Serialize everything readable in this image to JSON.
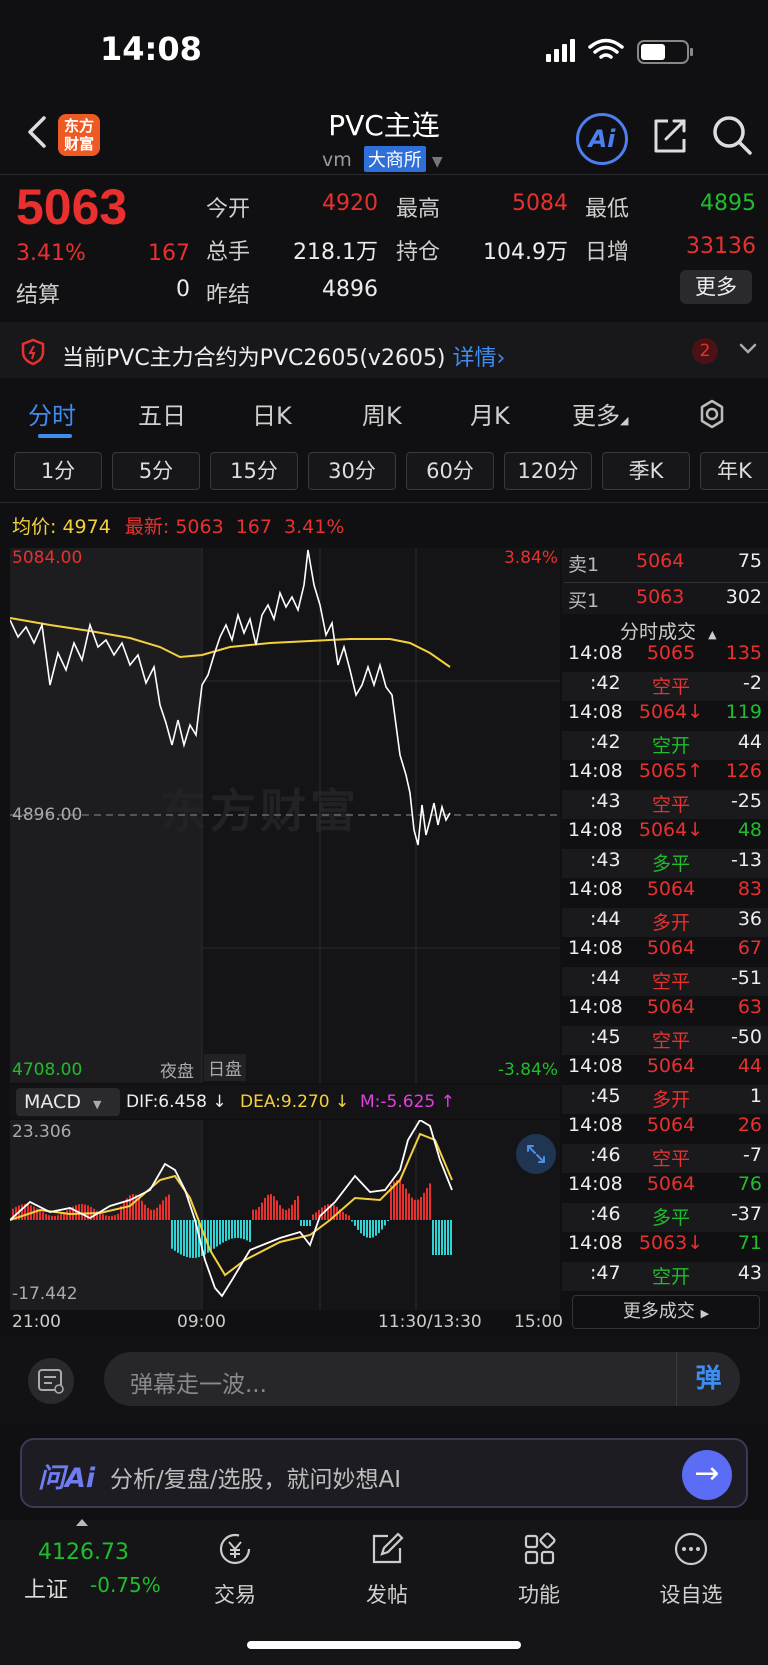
{
  "status_bar": {
    "time": "14:08"
  },
  "nav": {
    "logo_text": "东方财富",
    "title": "PVC主连",
    "code": "vm",
    "exchange": "大商所",
    "ai_label": "Ai"
  },
  "quote": {
    "price": "5063",
    "change_pct": "3.41%",
    "change": "167",
    "settle_label": "结算",
    "settle_value": "0",
    "open_label": "今开",
    "open_value": "4920",
    "high_label": "最高",
    "high_value": "5084",
    "low_label": "最低",
    "low_value": "4895",
    "volume_label": "总手",
    "volume_value": "218.1万",
    "oi_label": "持仓",
    "oi_value": "104.9万",
    "daily_inc_label": "日增",
    "daily_inc_value": "33136",
    "prev_settle_label": "昨结",
    "prev_settle_value": "4896",
    "more_label": "更多"
  },
  "notice": {
    "text": "当前PVC主力合约为PVC2605(v2605)",
    "link": "详情",
    "badge": "2"
  },
  "tabs": [
    "分时",
    "五日",
    "日K",
    "周K",
    "月K",
    "更多"
  ],
  "periods": [
    "1分",
    "5分",
    "15分",
    "30分",
    "60分",
    "120分",
    "季K",
    "年K"
  ],
  "chart_header": {
    "avg_label": "均价:",
    "avg_value": "4974",
    "latest_label": "最新:",
    "latest_value": "5063",
    "latest_change": "167",
    "latest_pct": "3.41%"
  },
  "chart_labels": {
    "y_top": "5084.00",
    "y_mid": "4896.00",
    "y_bottom": "4708.00",
    "pct_top": "3.84%",
    "pct_bottom": "-3.84%",
    "night_session": "夜盘",
    "day_session": "日盘",
    "watermark": "东方财富",
    "time_start": "21:00",
    "time_open": "09:00",
    "time_mid": "11:30/13:30",
    "time_end": "15:00"
  },
  "macd": {
    "selector": "MACD",
    "dif": "DIF:6.458 ↓",
    "dea": "DEA:9.270 ↓",
    "m": "M:-5.625 ↑",
    "y_top": "23.306",
    "y_bottom": "-17.442"
  },
  "order_book": {
    "sell_label": "卖1",
    "sell_price": "5064",
    "sell_vol": "75",
    "buy_label": "买1",
    "buy_price": "5063",
    "buy_vol": "302"
  },
  "trades_header": "分时成交",
  "trades": [
    {
      "time": "14:08",
      "price": "5065",
      "vol": "135",
      "pc": "red",
      "vc": "red"
    },
    {
      "time": ":42",
      "price": "空平",
      "vol": "-2",
      "pc": "red",
      "vc": "white"
    },
    {
      "time": "14:08",
      "price": "5064↓",
      "vol": "119",
      "pc": "red",
      "vc": "green"
    },
    {
      "time": ":42",
      "price": "空开",
      "vol": "44",
      "pc": "green",
      "vc": "white"
    },
    {
      "time": "14:08",
      "price": "5065↑",
      "vol": "126",
      "pc": "red",
      "vc": "red"
    },
    {
      "time": ":43",
      "price": "空平",
      "vol": "-25",
      "pc": "red",
      "vc": "white"
    },
    {
      "time": "14:08",
      "price": "5064↓",
      "vol": "48",
      "pc": "red",
      "vc": "green"
    },
    {
      "time": ":43",
      "price": "多平",
      "vol": "-13",
      "pc": "green",
      "vc": "white"
    },
    {
      "time": "14:08",
      "price": "5064",
      "vol": "83",
      "pc": "red",
      "vc": "red"
    },
    {
      "time": ":44",
      "price": "多开",
      "vol": "36",
      "pc": "red",
      "vc": "white"
    },
    {
      "time": "14:08",
      "price": "5064",
      "vol": "67",
      "pc": "red",
      "vc": "red"
    },
    {
      "time": ":44",
      "price": "空平",
      "vol": "-51",
      "pc": "red",
      "vc": "white"
    },
    {
      "time": "14:08",
      "price": "5064",
      "vol": "63",
      "pc": "red",
      "vc": "red"
    },
    {
      "time": ":45",
      "price": "空平",
      "vol": "-50",
      "pc": "red",
      "vc": "white"
    },
    {
      "time": "14:08",
      "price": "5064",
      "vol": "44",
      "pc": "red",
      "vc": "red"
    },
    {
      "time": ":45",
      "price": "多开",
      "vol": "1",
      "pc": "red",
      "vc": "white"
    },
    {
      "time": "14:08",
      "price": "5064",
      "vol": "26",
      "pc": "red",
      "vc": "red"
    },
    {
      "time": ":46",
      "price": "空平",
      "vol": "-7",
      "pc": "red",
      "vc": "white"
    },
    {
      "time": "14:08",
      "price": "5064",
      "vol": "76",
      "pc": "red",
      "vc": "green"
    },
    {
      "time": ":46",
      "price": "多平",
      "vol": "-37",
      "pc": "green",
      "vc": "white"
    },
    {
      "time": "14:08",
      "price": "5063↓",
      "vol": "71",
      "pc": "red",
      "vc": "green"
    },
    {
      "time": ":47",
      "price": "空开",
      "vol": "43",
      "pc": "green",
      "vc": "white"
    }
  ],
  "more_trades": "更多成交",
  "danmu": {
    "placeholder": "弹幕走一波...",
    "button": "弹"
  },
  "ai_bar": {
    "label": "问Ai",
    "text": "分析/复盘/选股，就问妙想AI"
  },
  "bottom_nav": {
    "index_value": "4126.73",
    "index_name": "上证",
    "index_change": "-0.75%",
    "items": [
      "交易",
      "发帖",
      "功能",
      "设自选"
    ]
  },
  "colors": {
    "up": "#e8312f",
    "down": "#1fbd2c",
    "accent": "#3f8df0",
    "avg_line": "#f4d03f"
  }
}
